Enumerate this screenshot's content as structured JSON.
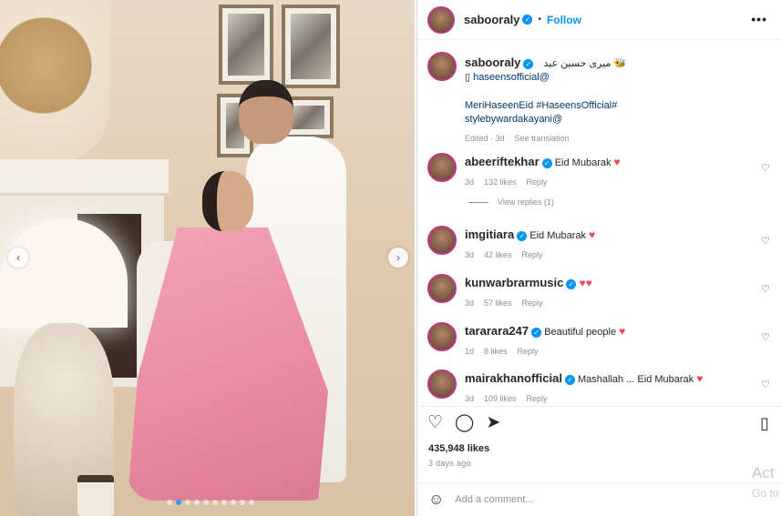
{
  "post": {
    "username": "sabooraly",
    "follow_label": "Follow",
    "dot": "•",
    "more_icon": "•••",
    "prev_icon": "‹",
    "next_icon": "›",
    "caption": {
      "line1": "میری حسین عید",
      "emoji": "🐝",
      "line2_prefix": "▯",
      "line2_tag": "haseensofficial@",
      "line3": "MeriHaseenEid #HaseensOfficial#",
      "line4": "stylebywardakayani@",
      "meta_edited": "Edited · 3d",
      "meta_translate": "See translation"
    },
    "likes": "435,948 likes",
    "date": "3 days ago",
    "add_comment_placeholder": "Add a comment..."
  },
  "comments": [
    {
      "user": "abeeriftekhar",
      "text": "Eid Mubarak",
      "hearts": "♥",
      "age": "3d",
      "likes": "132 likes",
      "reply": "Reply"
    },
    {
      "user": "imgitiara",
      "text": "Eid Mubarak",
      "hearts": "♥",
      "age": "3d",
      "likes": "42 likes",
      "reply": "Reply"
    },
    {
      "user": "kunwarbrarmusic",
      "text": "",
      "hearts": "♥♥",
      "age": "3d",
      "likes": "57 likes",
      "reply": "Reply"
    },
    {
      "user": "tararara247",
      "text": "Beautiful people",
      "hearts": "♥",
      "age": "1d",
      "likes": "8 likes",
      "reply": "Reply"
    },
    {
      "user": "mairakhanofficial",
      "text": "Mashallah ... Eid Mubarak",
      "hearts": "♥",
      "age": "3d",
      "likes": "109 likes",
      "reply": "Reply"
    }
  ],
  "view_replies": "View replies (1)",
  "icons": {
    "like": "♡",
    "comment": "◯",
    "share": "➤",
    "save": "▯",
    "emoji": "☺",
    "verified": "✓"
  },
  "overlay": {
    "activate1": "Act",
    "activate2": "Go to"
  },
  "colors": {
    "accent": "#0095f6",
    "heart": "#ed4956",
    "story_ring": "#c13584"
  }
}
